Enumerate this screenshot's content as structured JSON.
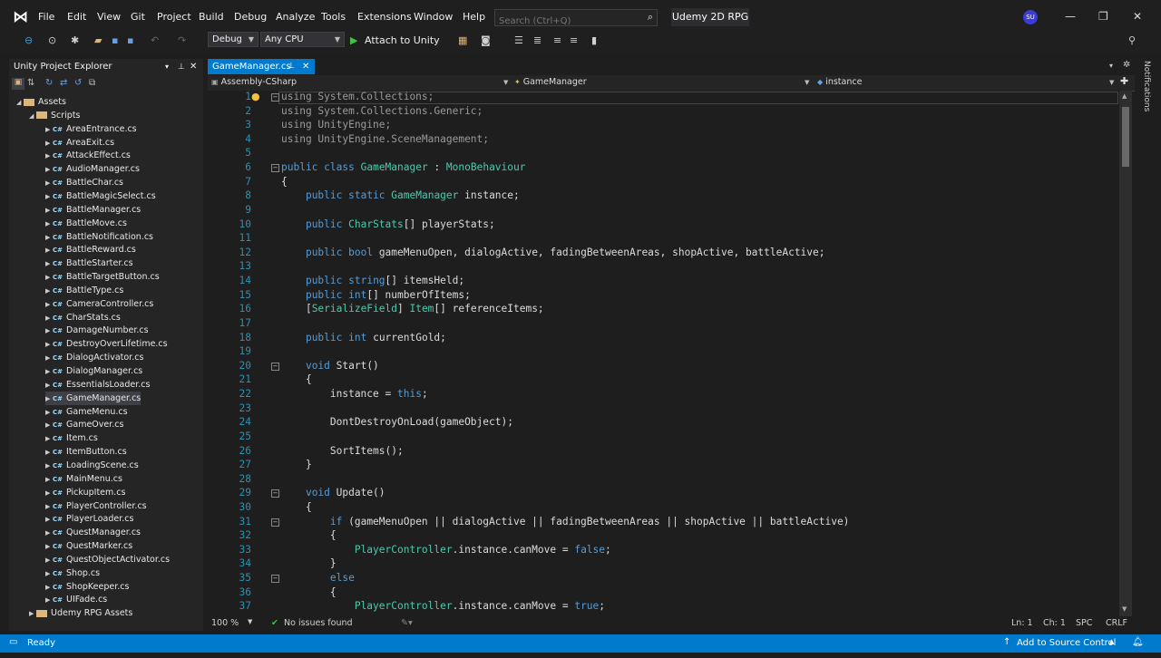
{
  "window": {
    "solution_name": "Udemy 2D RPG",
    "avatar_initials": "SU"
  },
  "menu": [
    "File",
    "Edit",
    "View",
    "Git",
    "Project",
    "Build",
    "Debug",
    "Analyze",
    "Tools",
    "Extensions",
    "Window",
    "Help"
  ],
  "search": {
    "placeholder": "Search (Ctrl+Q)"
  },
  "toolbar": {
    "config": "Debug",
    "platform": "Any CPU",
    "run_label": "Attach to Unity"
  },
  "sidebar": {
    "title": "Unity Project Explorer",
    "assets_label": "Assets",
    "scripts_label": "Scripts",
    "files": [
      "AreaEntrance.cs",
      "AreaExit.cs",
      "AttackEffect.cs",
      "AudioManager.cs",
      "BattleChar.cs",
      "BattleMagicSelect.cs",
      "BattleManager.cs",
      "BattleMove.cs",
      "BattleNotification.cs",
      "BattleReward.cs",
      "BattleStarter.cs",
      "BattleTargetButton.cs",
      "BattleType.cs",
      "CameraController.cs",
      "CharStats.cs",
      "DamageNumber.cs",
      "DestroyOverLifetime.cs",
      "DialogActivator.cs",
      "DialogManager.cs",
      "EssentialsLoader.cs",
      "GameManager.cs",
      "GameMenu.cs",
      "GameOver.cs",
      "Item.cs",
      "ItemButton.cs",
      "LoadingScene.cs",
      "MainMenu.cs",
      "PickupItem.cs",
      "PlayerController.cs",
      "PlayerLoader.cs",
      "QuestManager.cs",
      "QuestMarker.cs",
      "QuestObjectActivator.cs",
      "Shop.cs",
      "ShopKeeper.cs",
      "UIFade.cs"
    ],
    "selected_file": "GameManager.cs",
    "assets_folder": "Udemy RPG Assets"
  },
  "editor": {
    "tab_label": "GameManager.cs",
    "nav_project": "Assembly-CSharp",
    "nav_class": "GameManager",
    "nav_member": "instance",
    "lines": [
      "using System.Collections;",
      "using System.Collections.Generic;",
      "using UnityEngine;",
      "using UnityEngine.SceneManagement;",
      "",
      "public class GameManager : MonoBehaviour",
      "{",
      "    public static GameManager instance;",
      "",
      "    public CharStats[] playerStats;",
      "",
      "    public bool gameMenuOpen, dialogActive, fadingBetweenAreas, shopActive, battleActive;",
      "",
      "    public string[] itemsHeld;",
      "    public int[] numberOfItems;",
      "    [SerializeField] Item[] referenceItems;",
      "",
      "    public int currentGold;",
      "",
      "    void Start()",
      "    {",
      "        instance = this;",
      "",
      "        DontDestroyOnLoad(gameObject);",
      "",
      "        SortItems();",
      "    }",
      "",
      "    void Update()",
      "    {",
      "        if (gameMenuOpen || dialogActive || fadingBetweenAreas || shopActive || battleActive)",
      "        {",
      "            PlayerController.instance.canMove = false;",
      "        }",
      "        else",
      "        {",
      "            PlayerController.instance.canMove = true;"
    ]
  },
  "editor_status": {
    "zoom": "100 %",
    "issues": "No issues found",
    "line": "Ln: 1",
    "col": "Ch: 1",
    "spc": "SPC",
    "eol": "CRLF"
  },
  "statusbar": {
    "ready": "Ready",
    "source_control": "Add to Source Control"
  },
  "notifications_label": "Notifications"
}
